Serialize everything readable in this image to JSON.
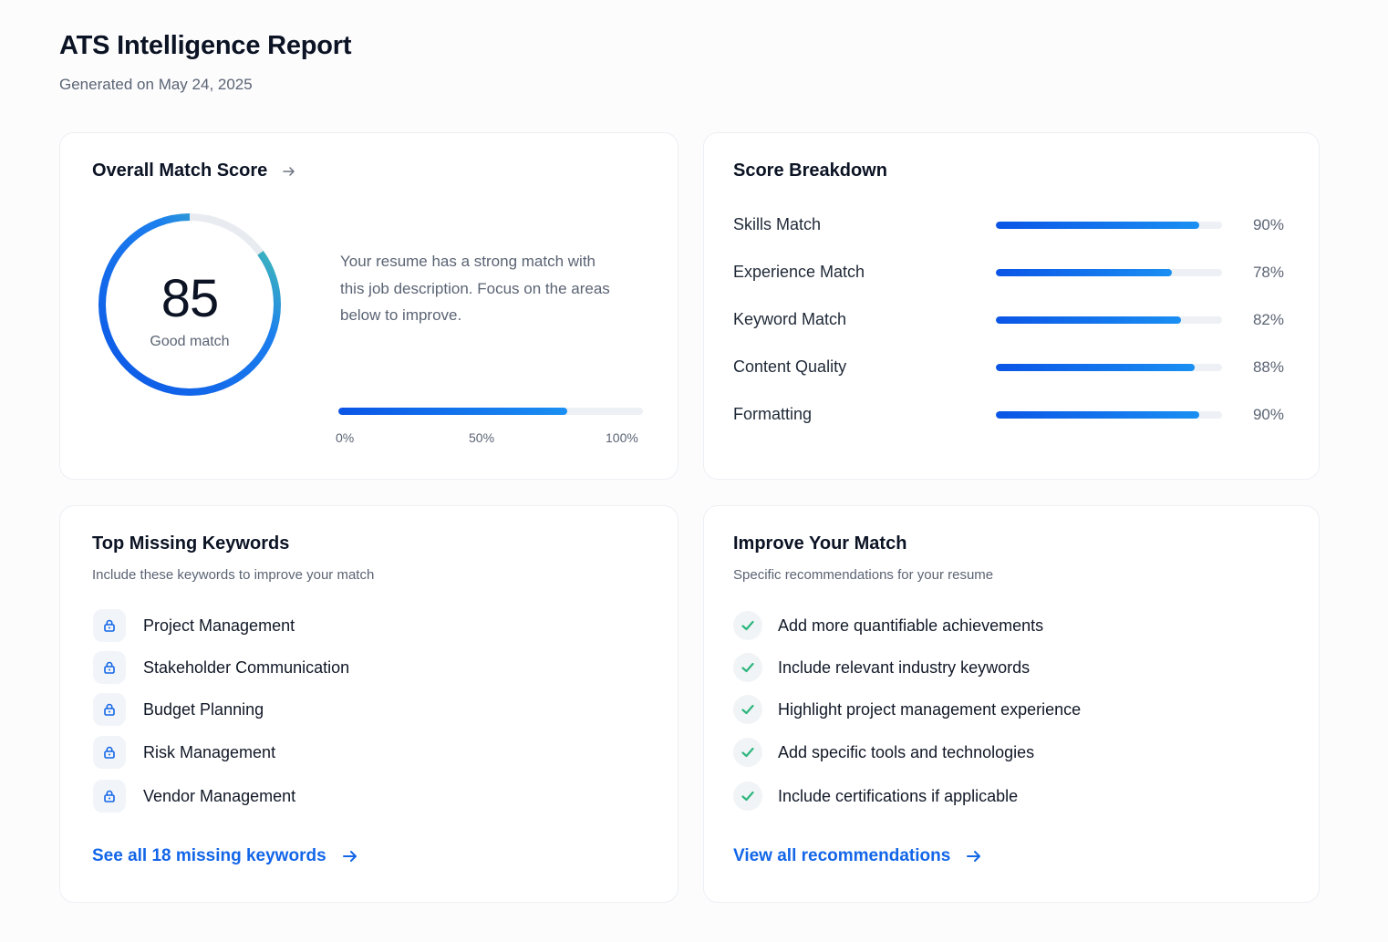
{
  "header": {
    "title": "ATS Intelligence Report",
    "subtitle": "Generated on May 24, 2025"
  },
  "overall": {
    "title": "Overall Match Score",
    "score": "85",
    "score_value": 85,
    "score_label": "Good match",
    "description": "Your resume has a strong match with this job description. Focus on the areas below to improve.",
    "bar_fill_percent": 75,
    "ticks": [
      "0%",
      "50%",
      "100%"
    ],
    "colors": {
      "gauge_start": "#0b55e6",
      "gauge_end": "#3ccf9a",
      "track": "#e8ebf0"
    }
  },
  "breakdown": {
    "title": "Score Breakdown",
    "items": [
      {
        "label": "Skills Match",
        "value": "90%",
        "percent": 90
      },
      {
        "label": "Experience Match",
        "value": "78%",
        "percent": 78
      },
      {
        "label": "Keyword Match",
        "value": "82%",
        "percent": 82
      },
      {
        "label": "Content Quality",
        "value": "88%",
        "percent": 88
      },
      {
        "label": "Formatting",
        "value": "90%",
        "percent": 90
      }
    ]
  },
  "missing": {
    "title": "Top Missing Keywords",
    "subtitle": "Include these keywords to improve your match",
    "icon": "lock-icon",
    "items": [
      "Project Management",
      "Stakeholder Communication",
      "Budget Planning",
      "Risk Management",
      "Vendor Management"
    ],
    "link": "See all 18 missing keywords"
  },
  "improve": {
    "title": "Improve Your Match",
    "subtitle": "Specific recommendations for your resume",
    "icon": "check-icon",
    "items": [
      "Add more quantifiable achievements",
      "Include relevant industry keywords",
      "Highlight project management experience",
      "Add specific tools and technologies",
      "Include certifications if applicable"
    ],
    "link": "View all recommendations"
  },
  "accent": "#1366e8",
  "success": "#2cb67d"
}
